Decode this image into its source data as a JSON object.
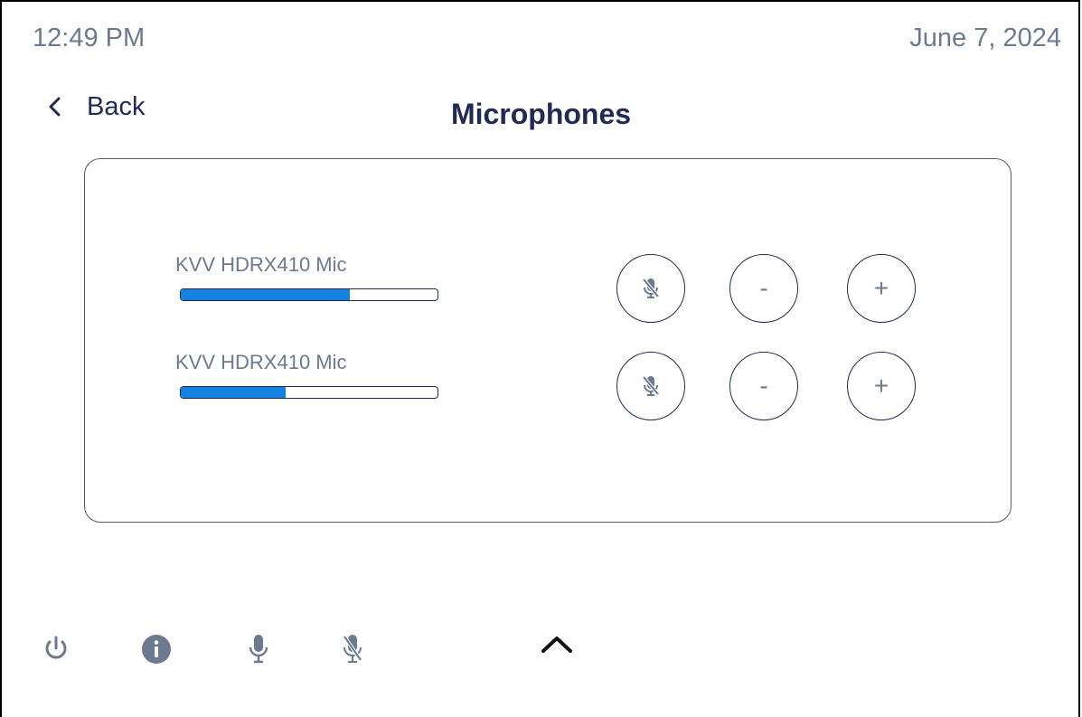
{
  "status": {
    "time": "12:49 PM",
    "date": "June 7, 2024"
  },
  "nav": {
    "back_label": "Back",
    "back_icon": "chevron-left-icon"
  },
  "page": {
    "title": "Microphones"
  },
  "microphones": [
    {
      "name": "KVV HDRX410 Mic",
      "level_percent": 66,
      "mute_icon": "mic-muted-icon",
      "minus_label": "-",
      "plus_label": "+"
    },
    {
      "name": "KVV HDRX410 Mic",
      "level_percent": 41,
      "mute_icon": "mic-muted-icon",
      "minus_label": "-",
      "plus_label": "+"
    }
  ],
  "footer": {
    "icons": [
      "power-icon",
      "info-icon",
      "mic-icon",
      "mic-muted-icon",
      "chevron-up-icon"
    ]
  },
  "colors": {
    "accent": "#1483e0",
    "primary_text": "#1f2a55",
    "secondary_text": "#6b7a90"
  }
}
